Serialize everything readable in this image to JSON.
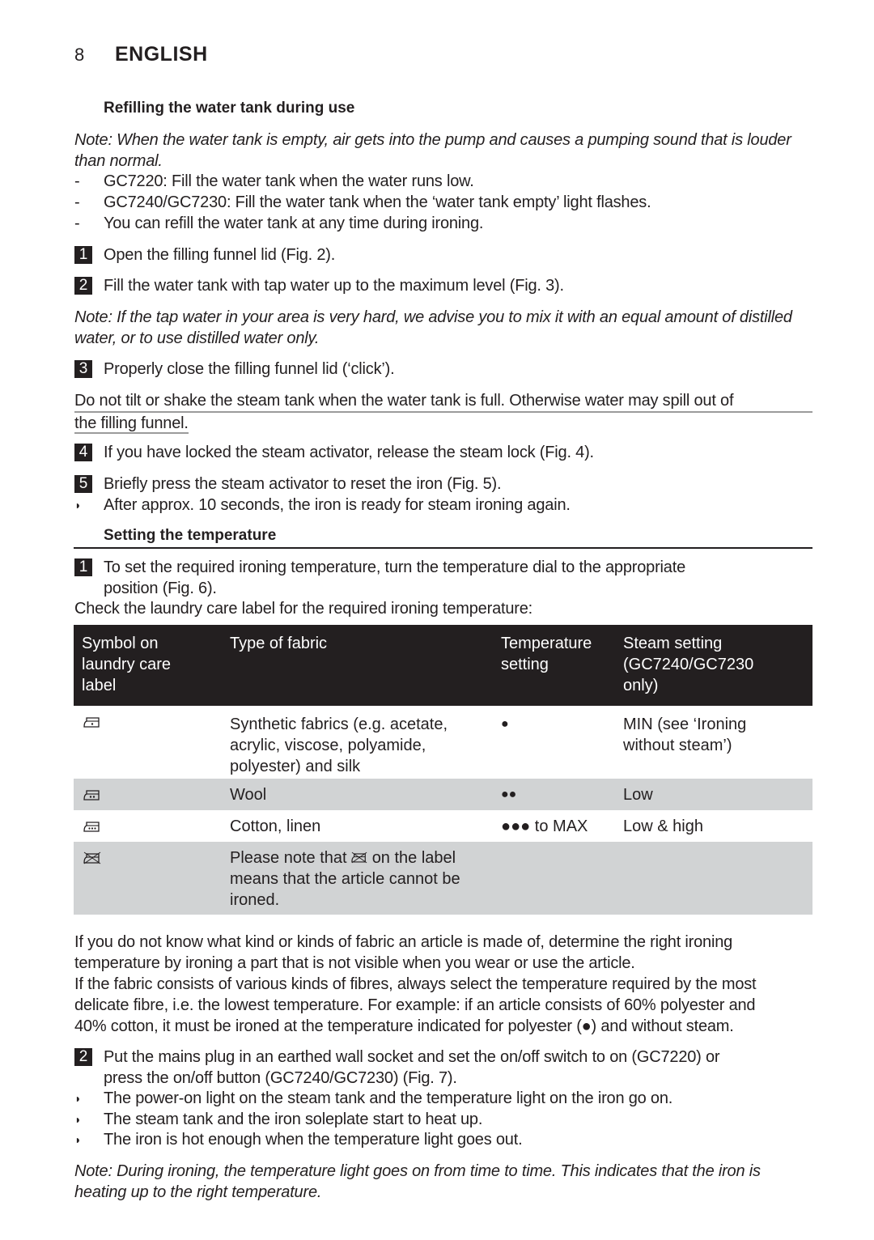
{
  "header": {
    "page_number": "8",
    "language": "ENGLISH"
  },
  "refill_section": {
    "title": "Refilling the water tank during use",
    "note_line1": "Note: When the water tank is empty, air gets into the pump and causes a pumping sound that is louder",
    "note_line2": "than normal.",
    "bullets": [
      "GC7220: Fill the water tank when the water runs low.",
      "GC7240/GC7230: Fill the water tank when the ‘water tank empty’ light flashes.",
      "You can refill the water tank at any time during ironing."
    ],
    "dash": "-",
    "steps": [
      {
        "num": "1",
        "text": "Open the filling funnel lid (Fig. 2)."
      },
      {
        "num": "2",
        "text": "Fill the water tank with tap water up to the maximum level (Fig. 3)."
      }
    ],
    "hard_water_note_line1": "Note: If the tap water in your area is very hard, we advise you to mix it with an equal amount of distilled",
    "hard_water_note_line2": "water, or to use distilled water only.",
    "step3": {
      "num": "3",
      "text": "Properly close the filling funnel lid (‘click’)."
    },
    "warning_line1": "Do not tilt or shake the steam tank when the water tank is full. Otherwise water may spill out of",
    "warning_line2": "the filling funnel.",
    "step4": {
      "num": "4",
      "text": "If you have locked the steam activator, release the steam lock (Fig. 4)."
    },
    "step5": {
      "num": "5",
      "text": "Briefly press the steam activator to reset the iron (Fig. 5)."
    },
    "result5": "After approx. 10 seconds, the iron is ready for steam ironing again."
  },
  "temperature_section": {
    "title": "Setting the temperature",
    "step1": {
      "num": "1",
      "line1": "To set the required ironing temperature, turn the temperature dial to the appropriate",
      "line2": "position (Fig. 6)."
    },
    "check_text": "Check the laundry care label for the required ironing temperature:",
    "table": {
      "headers": [
        [
          "Symbol on",
          "laundry care",
          "label"
        ],
        [
          "Type of fabric"
        ],
        [
          "Temperature",
          "setting"
        ],
        [
          "Steam setting",
          "(GC7240/GC7230",
          "only)"
        ]
      ],
      "rows": [
        {
          "symbol": "iron-one-dot-icon",
          "fabric": [
            "Synthetic fabrics (e.g. acetate,",
            "acrylic, viscose, polyamide,",
            "polyester) and silk"
          ],
          "temperature": "●",
          "steam": [
            "MIN (see ‘Ironing",
            "without steam’)"
          ]
        },
        {
          "symbol": "iron-two-dots-icon",
          "fabric": [
            "Wool"
          ],
          "temperature": "●●",
          "steam": [
            "Low"
          ]
        },
        {
          "symbol": "iron-three-dots-icon",
          "fabric": [
            "Cotton, linen"
          ],
          "temperature": "●●● to MAX",
          "steam": [
            "Low & high"
          ]
        },
        {
          "symbol": "do-not-iron-icon",
          "fabric_prefix": "Please note that",
          "fabric_suffix": "on the label",
          "fabric": [
            "means that the article cannot be",
            "ironed."
          ],
          "temperature": "",
          "steam": []
        }
      ]
    },
    "para1_line1": "If you do not know what kind or kinds of fabric an article is made of, determine the right ironing",
    "para1_line2": "temperature by ironing a part that is not visible when you wear or use the article.",
    "para2_line1": "If the fabric consists of various kinds of fibres, always select the temperature required by the most",
    "para2_line2": "delicate fibre, i.e. the lowest temperature. For example: if an article consists of 60% polyester and",
    "para2_line3": "40% cotton, it must be ironed at the temperature indicated for polyester (●) and without steam.",
    "step2": {
      "num": "2",
      "line1": "Put the mains plug in an earthed wall socket and set the on/off switch to on (GC7220) or",
      "line2": "press the on/off button (GC7240/GC7230) (Fig. 7)."
    },
    "results": [
      "The power-on light on the steam tank and the temperature light on the iron go on.",
      "The steam tank and the iron soleplate start to heat up.",
      "The iron is hot enough when the temperature light goes out."
    ],
    "final_note_line1": "Note: During ironing, the temperature light goes on from time to time. This indicates that the iron is",
    "final_note_line2": "heating up to the right temperature."
  },
  "colors": {
    "text": "#231f20",
    "table_header_bg": "#231f20",
    "table_row_gray": "#d1d3d4"
  }
}
